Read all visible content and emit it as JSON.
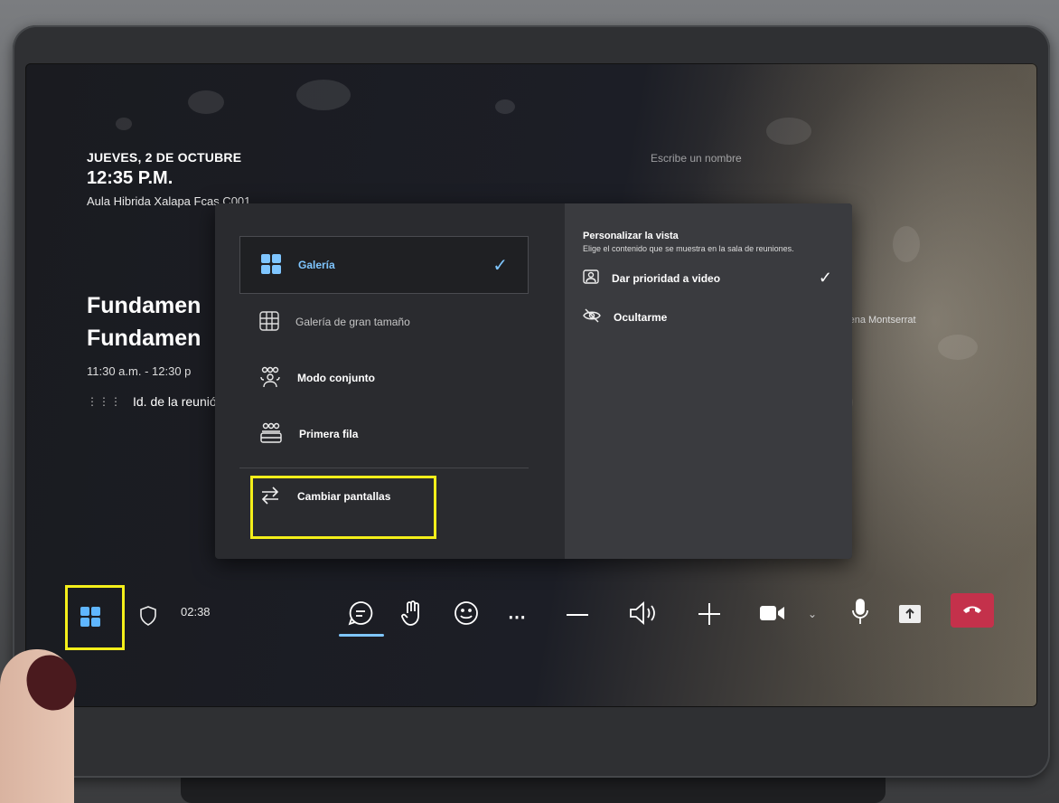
{
  "header": {
    "date": "JUEVES, 2 DE OCTUBRE",
    "time": "12:35 P.M.",
    "room": "Aula Hibrida Xalapa Fcas C001"
  },
  "meeting": {
    "title_line1": "Fundamen",
    "title_line2": "Fundamen",
    "time_range": "11:30 a.m. - 12:30 p",
    "id_label": "Id. de la reunió"
  },
  "participants": {
    "search_placeholder": "Escribe un nombre",
    "visible_name": "imena Montserrat"
  },
  "layout_menu": {
    "options": [
      {
        "label": "Galería",
        "icon": "gallery-icon",
        "selected": true
      },
      {
        "label": "Galería de gran tamaño",
        "icon": "large-gallery-icon",
        "selected": false
      },
      {
        "label": "Modo conjunto",
        "icon": "together-mode-icon",
        "selected": false
      },
      {
        "label": "Primera fila",
        "icon": "front-row-icon",
        "selected": false
      }
    ],
    "switch_screens_label": "Cambiar pantallas"
  },
  "customize_view": {
    "title": "Personalizar la vista",
    "subtitle": "Elige el contenido que se muestra en la sala de reuniones.",
    "items": [
      {
        "label": "Dar prioridad a video",
        "icon": "video-priority-icon",
        "checked": true
      },
      {
        "label": "Ocultarme",
        "icon": "hide-me-icon",
        "checked": false
      }
    ]
  },
  "toolbar": {
    "call_duration": "02:38"
  },
  "colors": {
    "accent": "#7fc6ff",
    "highlight": "#f4ef1a",
    "hangup": "#c4314b"
  }
}
